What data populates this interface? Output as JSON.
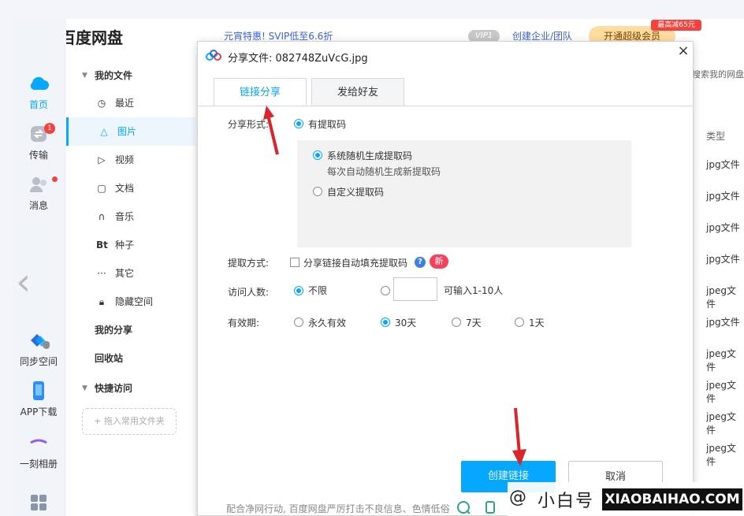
{
  "app": {
    "brand": "百度网盘"
  },
  "rail": [
    {
      "label": "首页",
      "icon": "home-cloud-icon",
      "active": true
    },
    {
      "label": "传输",
      "icon": "transfer-icon",
      "badge": "1"
    },
    {
      "label": "消息",
      "icon": "message-icon"
    },
    {
      "label": "同步空间",
      "icon": "sync-icon"
    },
    {
      "label": "APP下载",
      "icon": "phone-icon"
    },
    {
      "label": "一刻相册",
      "icon": "album-icon"
    }
  ],
  "categories": {
    "my_files": "我的文件",
    "items": [
      "最近",
      "图片",
      "视频",
      "文档",
      "音乐",
      "种子",
      "其它",
      "隐藏空间"
    ],
    "my_share": "我的分享",
    "recycle": "回收站",
    "quick_access": "快捷访问",
    "drop_hint": "+ 拖入常用文件夹"
  },
  "top_bar": {
    "promo": "元宵特惠! SVIP低至6.6折",
    "vip_pill": "VIP1",
    "business_link": "创建企业/团队",
    "upgrade": "开通超级会员",
    "price_tag": "最高减65元"
  },
  "file_list": {
    "search_hint": "搜索我的网盘",
    "type_header": "类型",
    "types": [
      "jpg文件",
      "jpg文件",
      "jpg文件",
      "jpg文件",
      "jpeg文件",
      "jpg文件",
      "jpeg文件",
      "jpeg文件",
      "jpeg文件",
      "jpeg文件"
    ]
  },
  "dialog": {
    "title": "分享文件: 082748ZuVcG.jpg",
    "tabs": [
      "链接分享",
      "发给好友"
    ],
    "share_form_label": "分享形式:",
    "share_form_option": "有提取码",
    "system_code": "系统随机生成提取码",
    "system_code_hint": "每次自动随机生成新提取码",
    "custom_code": "自定义提取码",
    "fetch_label": "提取方式:",
    "fetch_option": "分享链接自动填充提取码",
    "new_badge": "新",
    "visitors_label": "访问人数:",
    "visitors_unlimited": "不限",
    "visitors_hint": "可输入1-10人",
    "validity_label": "有效期:",
    "validity_options": [
      "永久有效",
      "30天",
      "7天",
      "1天"
    ],
    "create_button": "创建链接",
    "cancel_button": "取消",
    "footer_note": "配合净网行动, 百度网盘严厉打击不良信息、色情低俗"
  },
  "watermark": {
    "cn": "小白号",
    "en": "XIAOBAIHAO.COM"
  },
  "colors": {
    "accent": "#06a7ff",
    "badge": "#f5423e",
    "arrow": "#d9262c"
  }
}
